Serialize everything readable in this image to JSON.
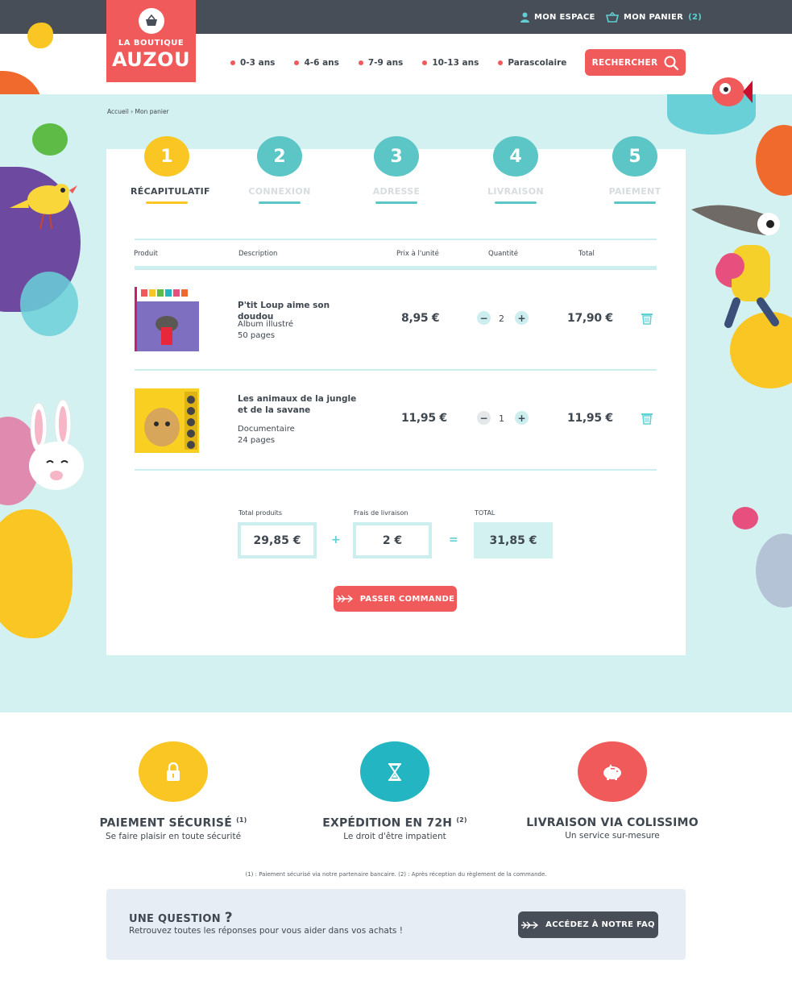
{
  "topbar": {
    "account_label": "MON ESPACE",
    "cart_label": "MON PANIER",
    "cart_count": "(2)"
  },
  "logo": {
    "line1": "LA BOUTIQUE",
    "line2": "AUZOU"
  },
  "nav": {
    "items": [
      {
        "label": "0-3 ans"
      },
      {
        "label": "4-6 ans"
      },
      {
        "label": "7-9 ans"
      },
      {
        "label": "10-13 ans"
      },
      {
        "label": "Parascolaire"
      }
    ]
  },
  "search": {
    "label": "RECHERCHER",
    "icon": "search-icon"
  },
  "breadcrumb": "Accueil › Mon panier",
  "steps": [
    {
      "number": "1",
      "label": "RÉCAPITULATIF",
      "active": true
    },
    {
      "number": "2",
      "label": "CONNEXION",
      "active": false
    },
    {
      "number": "3",
      "label": "ADRESSE",
      "active": false
    },
    {
      "number": "4",
      "label": "LIVRAISON",
      "active": false
    },
    {
      "number": "5",
      "label": "PAIEMENT",
      "active": false
    }
  ],
  "table": {
    "headers": {
      "product": "Produit",
      "description": "Description",
      "unit_price": "Prix à l'unité",
      "quantity": "Quantité",
      "total": "Total"
    },
    "rows": [
      {
        "title": "P'tit Loup aime son doudou",
        "type": "Album illustré",
        "pages": "50 pages",
        "unit_price": "8,95 €",
        "quantity": "2",
        "total": "17,90 €"
      },
      {
        "title": "Les animaux de la jungle et de la savane",
        "type": "Documentaire",
        "pages": "24 pages",
        "unit_price": "11,95 €",
        "quantity": "1",
        "total": "11,95 €"
      }
    ],
    "minus": "−",
    "plus": "+"
  },
  "totals": {
    "products_label": "Total produits",
    "products_value": "29,85 €",
    "shipping_label": "Frais de livraison",
    "shipping_value": "2 €",
    "total_label": "TOTAL",
    "total_value": "31,85 €",
    "plus_sign": "+",
    "equals_sign": "="
  },
  "order_button": "PASSER COMMANDE",
  "features": [
    {
      "title": "PAIEMENT SÉCURISÉ",
      "note": "(1)",
      "subtitle": "Se faire plaisir en toute sécurité",
      "icon": "lock-icon",
      "color": "#f9c623"
    },
    {
      "title": "EXPÉDITION EN 72H",
      "note": "(2)",
      "subtitle": "Le droit d'être impatient",
      "icon": "hourglass-icon",
      "color": "#23b5c2"
    },
    {
      "title": "LIVRAISON VIA COLISSIMO",
      "note": "",
      "subtitle": "Un service sur-mesure",
      "icon": "piggy-bank-icon",
      "color": "#f05a5a"
    }
  ],
  "footnote": "(1) : Paiement sécurisé via notre partenaire bancaire. (2) : Après réception du règlement de la commande.",
  "faq": {
    "question": "UNE QUESTION",
    "question_mark": "?",
    "text": "Retrouvez toutes les réponses pour vous aider dans vos achats !",
    "button": "ACCÉDEZ À NOTRE FAQ"
  },
  "colors": {
    "accent": "#f05a5a",
    "dark": "#474e57",
    "teal": "#5fd0d4",
    "band": "#d4f1f1",
    "step_active": "#f9c623",
    "step_inactive": "#5cc6c6"
  }
}
